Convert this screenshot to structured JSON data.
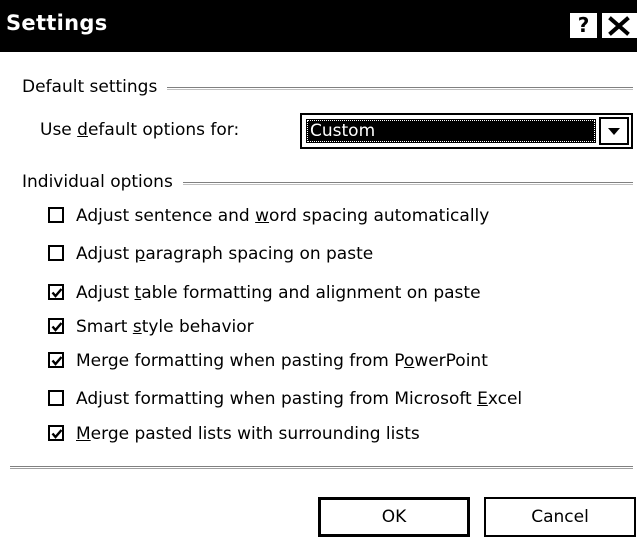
{
  "window": {
    "title": "Settings",
    "help_label": "?",
    "close_label": "×"
  },
  "default_settings": {
    "group_label": "Default settings",
    "use_default_label_pre": "Use ",
    "use_default_label_key": "d",
    "use_default_label_post": "efault options for:",
    "selected_value": "Custom"
  },
  "individual_options": {
    "group_label": "Individual options",
    "items": [
      {
        "pre": "Adjust sentence and ",
        "key": "w",
        "post": "ord spacing automatically",
        "checked": false
      },
      {
        "pre": "Adjust ",
        "key": "p",
        "post": "aragraph spacing on paste",
        "checked": false
      },
      {
        "pre": "Adjust ",
        "key": "t",
        "post": "able formatting and alignment on paste",
        "checked": true
      },
      {
        "pre": "Smart ",
        "key": "s",
        "post": "tyle behavior",
        "checked": true
      },
      {
        "pre": "Merge formatting when pasting from P",
        "key": "o",
        "post": "werPoint",
        "checked": true
      },
      {
        "pre": "Adjust formatting when pasting from Microsoft ",
        "key": "E",
        "post": "xcel",
        "checked": false
      },
      {
        "pre": "",
        "key": "M",
        "post": "erge pasted lists with surrounding lists",
        "checked": true
      }
    ]
  },
  "buttons": {
    "ok_label": "OK",
    "cancel_label": "Cancel"
  }
}
